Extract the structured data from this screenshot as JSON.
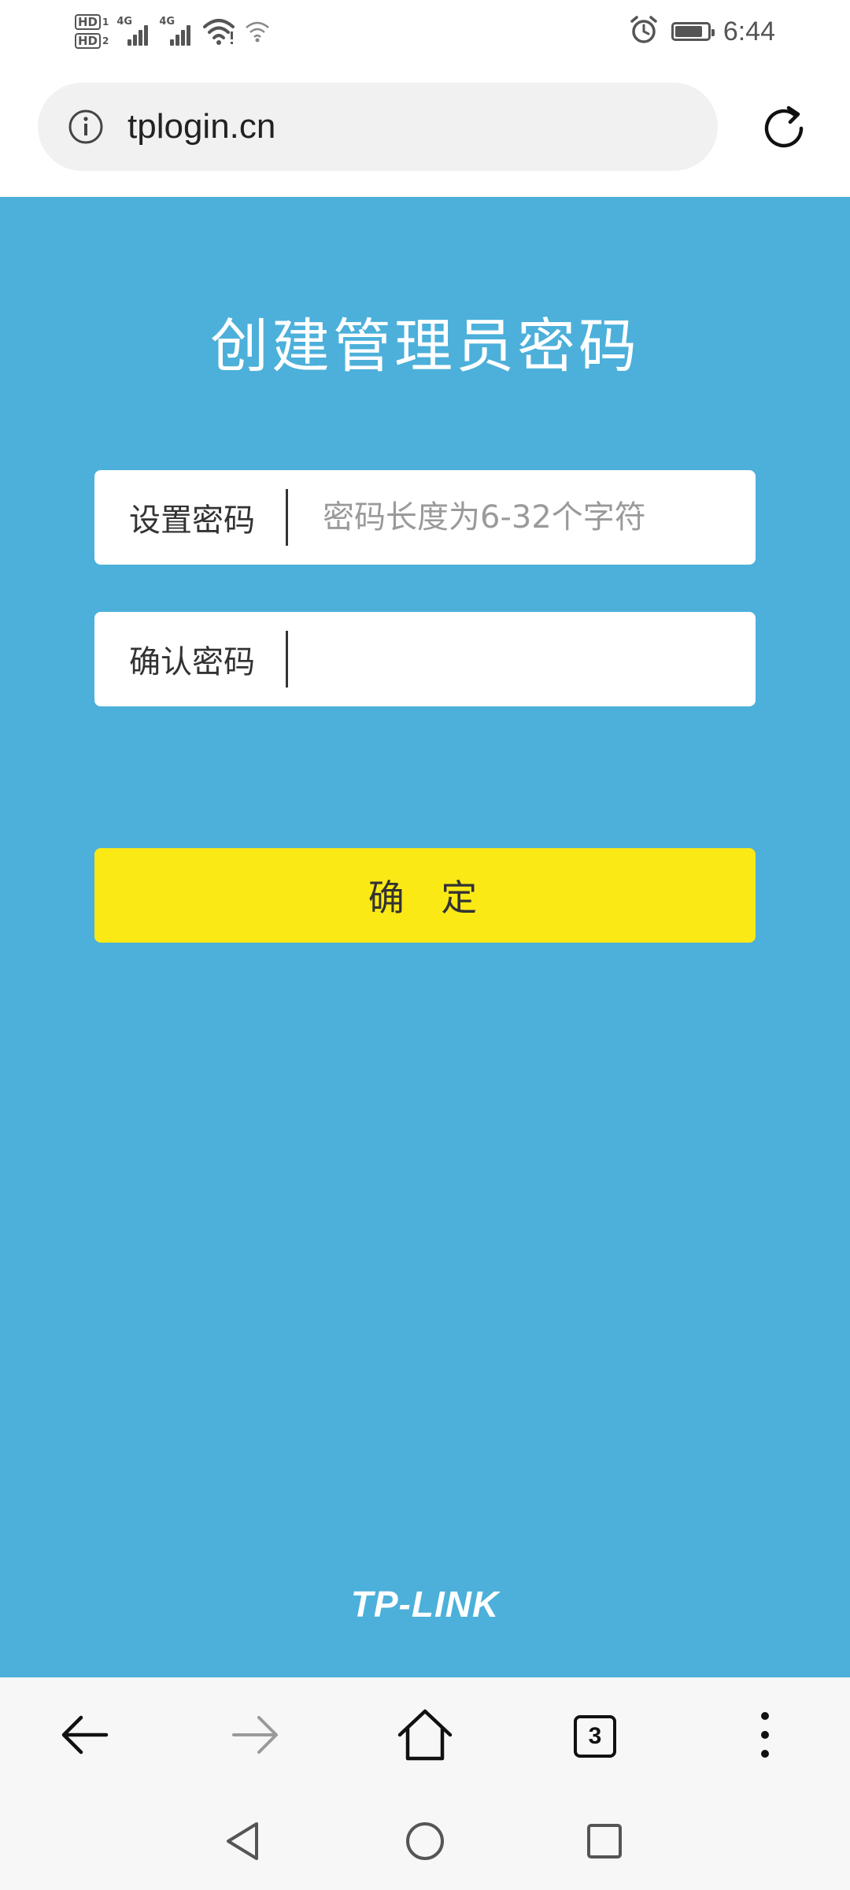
{
  "status_bar": {
    "sim1_label": "HD",
    "sim1_index": "1",
    "sim2_label": "HD",
    "sim2_index": "2",
    "network1": "4G",
    "network2": "4G",
    "battery_level": 0.85,
    "time": "6:44"
  },
  "address_bar": {
    "url": "tplogin.cn",
    "icons": {
      "info": "info-icon",
      "reload": "reload-icon"
    }
  },
  "page": {
    "title": "创建管理员密码",
    "password_field": {
      "label": "设置密码",
      "value": "",
      "placeholder": "密码长度为6-32个字符"
    },
    "confirm_field": {
      "label": "确认密码",
      "value": "",
      "placeholder": ""
    },
    "confirm_button": "确 定",
    "brand": "TP-LINK",
    "colors": {
      "background": "#4cb0da",
      "button": "#fbe916",
      "field": "#ffffff"
    }
  },
  "browser_toolbar": {
    "tab_count": "3",
    "icons": [
      "back-arrow-icon",
      "forward-arrow-icon",
      "home-icon",
      "tabs-icon",
      "more-menu-icon"
    ]
  },
  "nav_bar": {
    "icons": [
      "nav-back-icon",
      "nav-home-icon",
      "nav-recents-icon"
    ]
  }
}
